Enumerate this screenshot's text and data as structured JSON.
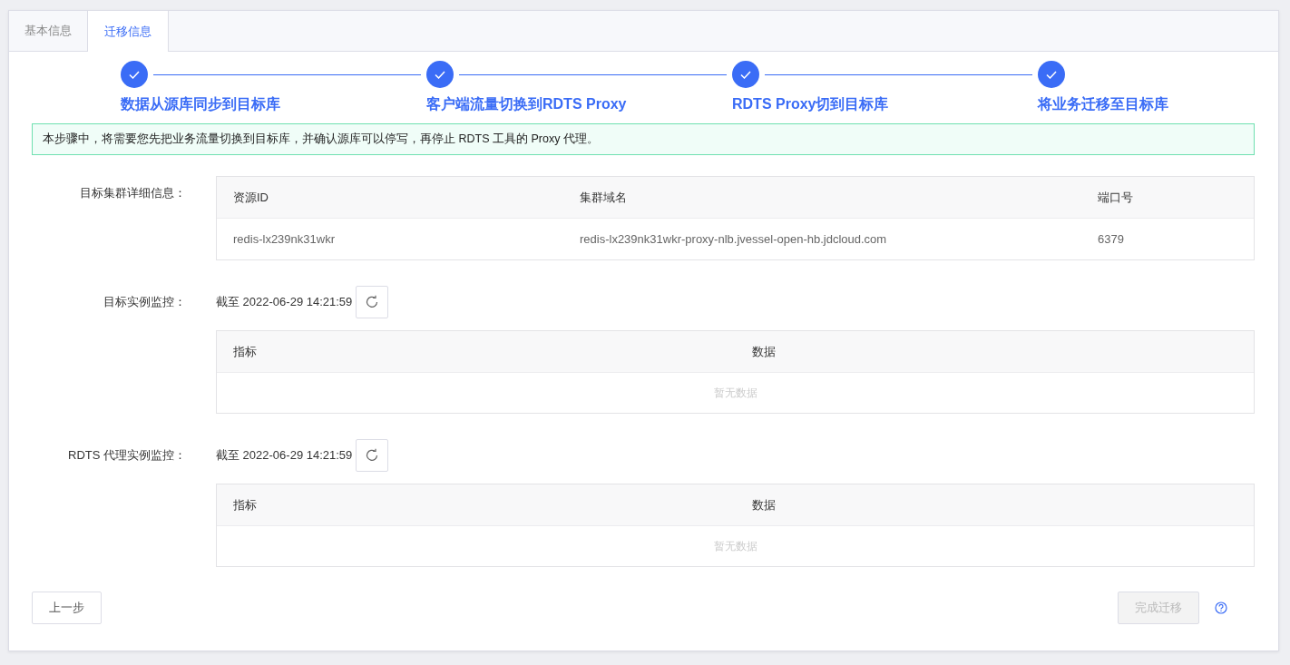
{
  "tabs": [
    {
      "label": "基本信息",
      "selected": false
    },
    {
      "label": "迁移信息",
      "selected": true
    }
  ],
  "steps": [
    {
      "label": "数据从源库同步到目标库",
      "done": true
    },
    {
      "label": "客户端流量切换到RDTS Proxy",
      "done": true
    },
    {
      "label": "RDTS Proxy切到目标库",
      "done": true
    },
    {
      "label": "将业务迁移至目标库",
      "done": true
    }
  ],
  "alert": "本步骤中，将需要您先把业务流量切换到目标库，并确认源库可以停写，再停止 RDTS 工具的 Proxy 代理。",
  "cluster_info": {
    "label": "目标集群详细信息：",
    "columns": [
      "资源ID",
      "集群域名",
      "端口号"
    ],
    "rows": [
      [
        "redis-lx239nk31wkr",
        "redis-lx239nk31wkr-proxy-nlb.jvessel-open-hb.jdcloud.com",
        "6379"
      ]
    ]
  },
  "monitors": [
    {
      "label": "目标实例监控：",
      "as_of": "截至 2022-06-29 14:21:59",
      "columns": [
        "指标",
        "数据"
      ],
      "empty_text": "暂无数据"
    },
    {
      "label": "RDTS 代理实例监控：",
      "as_of": "截至 2022-06-29 14:21:59",
      "columns": [
        "指标",
        "数据"
      ],
      "empty_text": "暂无数据"
    }
  ],
  "prev_button": "上一步",
  "finish_button": {
    "label": "完成迁移",
    "disabled": true
  }
}
